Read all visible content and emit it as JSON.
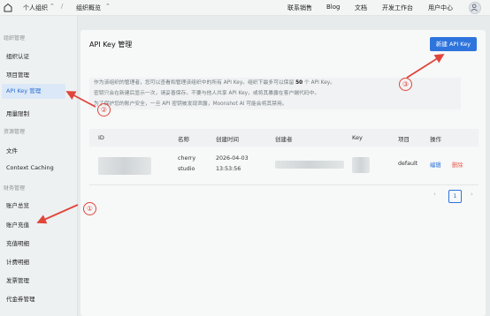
{
  "topbar": {
    "org_name": "个人组织",
    "page_name": "组织概览",
    "nav": [
      "联系销售",
      "Blog",
      "文档",
      "开发工作台",
      "用户中心"
    ]
  },
  "sidebar": {
    "groups": [
      "组织管理",
      "资源管理",
      "财务管理"
    ],
    "items": [
      "组织认证",
      "项目管理",
      "API Key 管理",
      "用量限制",
      "文件",
      "Context Caching",
      "账户总览",
      "账户充值",
      "充值明细",
      "计费明细",
      "发票管理",
      "代金券管理"
    ]
  },
  "main": {
    "title": "API Key 管理",
    "new_button": "新建 API Key",
    "notice": {
      "line1_a": "作为该组织的管理者，您可以查看和管理该组织中的所有 API Key。组织下最多可以保留 ",
      "line1_b": "50",
      "line1_c": " 个 API Key。",
      "line2": "密钥只会在新建后显示一次，请妥善保存。不要与他人共享 API Key，或将其暴露在客户端代码中。",
      "line3": "为了保护您的账户安全，一旦 API 密钥被发现泄露，Moonshot AI 可能会将其禁用。"
    },
    "table": {
      "headers": [
        "ID",
        "名称",
        "创建时间",
        "创建者",
        "Key",
        "项目",
        "操作"
      ],
      "rows": [
        {
          "name_l1": "cherry",
          "name_l2": "studio",
          "date": "2026-04-03",
          "time": "13:53:56",
          "project": "default",
          "edit": "编辑",
          "delete": "删除"
        }
      ]
    },
    "pagination": {
      "prev": "‹",
      "current": "1",
      "next": "›"
    }
  },
  "annotations": {
    "one": "①",
    "two": "②",
    "three": "③"
  },
  "colors": {
    "accent": "#2e74dd",
    "danger": "#e45a4b",
    "annotation": "#e0453a"
  }
}
